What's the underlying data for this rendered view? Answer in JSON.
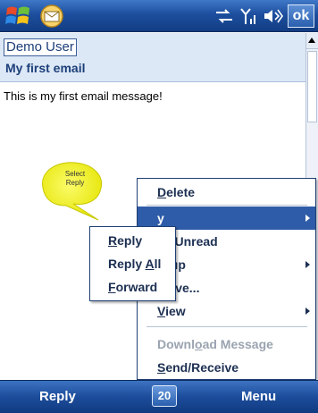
{
  "statusbar": {
    "ok_label": "ok",
    "icons": [
      "windows-start-icon",
      "mail-app-icon",
      "connectivity-icon",
      "signal-icon",
      "volume-icon"
    ]
  },
  "message": {
    "from": "Demo User",
    "subject": "My first email",
    "body": "This is my first email message!"
  },
  "callout": {
    "line1": "Select",
    "line2": "Reply",
    "color": "#f2f21a"
  },
  "menu": {
    "items": [
      {
        "pre": "",
        "u": "D",
        "post": "elete",
        "arrow": false,
        "selected": false,
        "disabled": false
      },
      {
        "pre": "",
        "u": "",
        "post": "y",
        "arrow": true,
        "selected": true,
        "disabled": false
      },
      {
        "pre": "",
        "u": "",
        "post": "as Unread",
        "arrow": false,
        "selected": false,
        "disabled": false
      },
      {
        "pre": "",
        "u": "",
        "post": "w up",
        "arrow": true,
        "selected": false,
        "disabled": false
      },
      {
        "pre": "",
        "u": "M",
        "post": "ove...",
        "arrow": false,
        "selected": false,
        "disabled": false
      },
      {
        "pre": "",
        "u": "V",
        "post": "iew",
        "arrow": true,
        "selected": false,
        "disabled": false
      },
      {
        "pre": "Downl",
        "u": "o",
        "post": "ad Message",
        "arrow": false,
        "selected": false,
        "disabled": true
      },
      {
        "pre": "",
        "u": "S",
        "post": "end/Receive",
        "arrow": false,
        "selected": false,
        "disabled": false
      }
    ]
  },
  "submenu": {
    "items": [
      {
        "pre": "",
        "u": "R",
        "post": "eply"
      },
      {
        "pre": "Reply ",
        "u": "A",
        "post": "ll"
      },
      {
        "pre": "",
        "u": "F",
        "post": "orward"
      }
    ]
  },
  "softkeys": {
    "left": "Reply",
    "sip": "20",
    "right": "Menu"
  },
  "colors": {
    "accent": "#2f5ca8",
    "bar": "#1d4f9e",
    "header_bg": "#dde8f6"
  }
}
